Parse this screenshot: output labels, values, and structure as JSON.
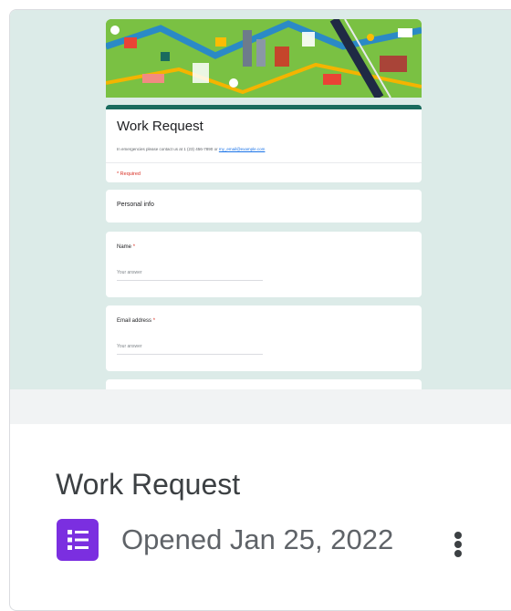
{
  "card": {
    "title": "Work Request",
    "opened_text": "Opened Jan 25, 2022",
    "app_icon": "google-forms-icon",
    "more_icon": "more-vert-icon"
  },
  "preview": {
    "form_title": "Work Request",
    "description_text": "In emergencies please contact us at 1 (23) 456-7890 or",
    "description_link": "my_email@example.com",
    "required_note": "* Required",
    "section_label": "Personal info",
    "questions": [
      {
        "label": "Name",
        "required_mark": "*",
        "placeholder": "Your answer"
      },
      {
        "label": "Email address",
        "required_mark": "*",
        "placeholder": "Your answer"
      }
    ]
  },
  "colors": {
    "forms_purple": "#7b2fe0",
    "header_teal": "#1a6b5e",
    "preview_background": "#dcebe8",
    "required_red": "#d93025"
  }
}
